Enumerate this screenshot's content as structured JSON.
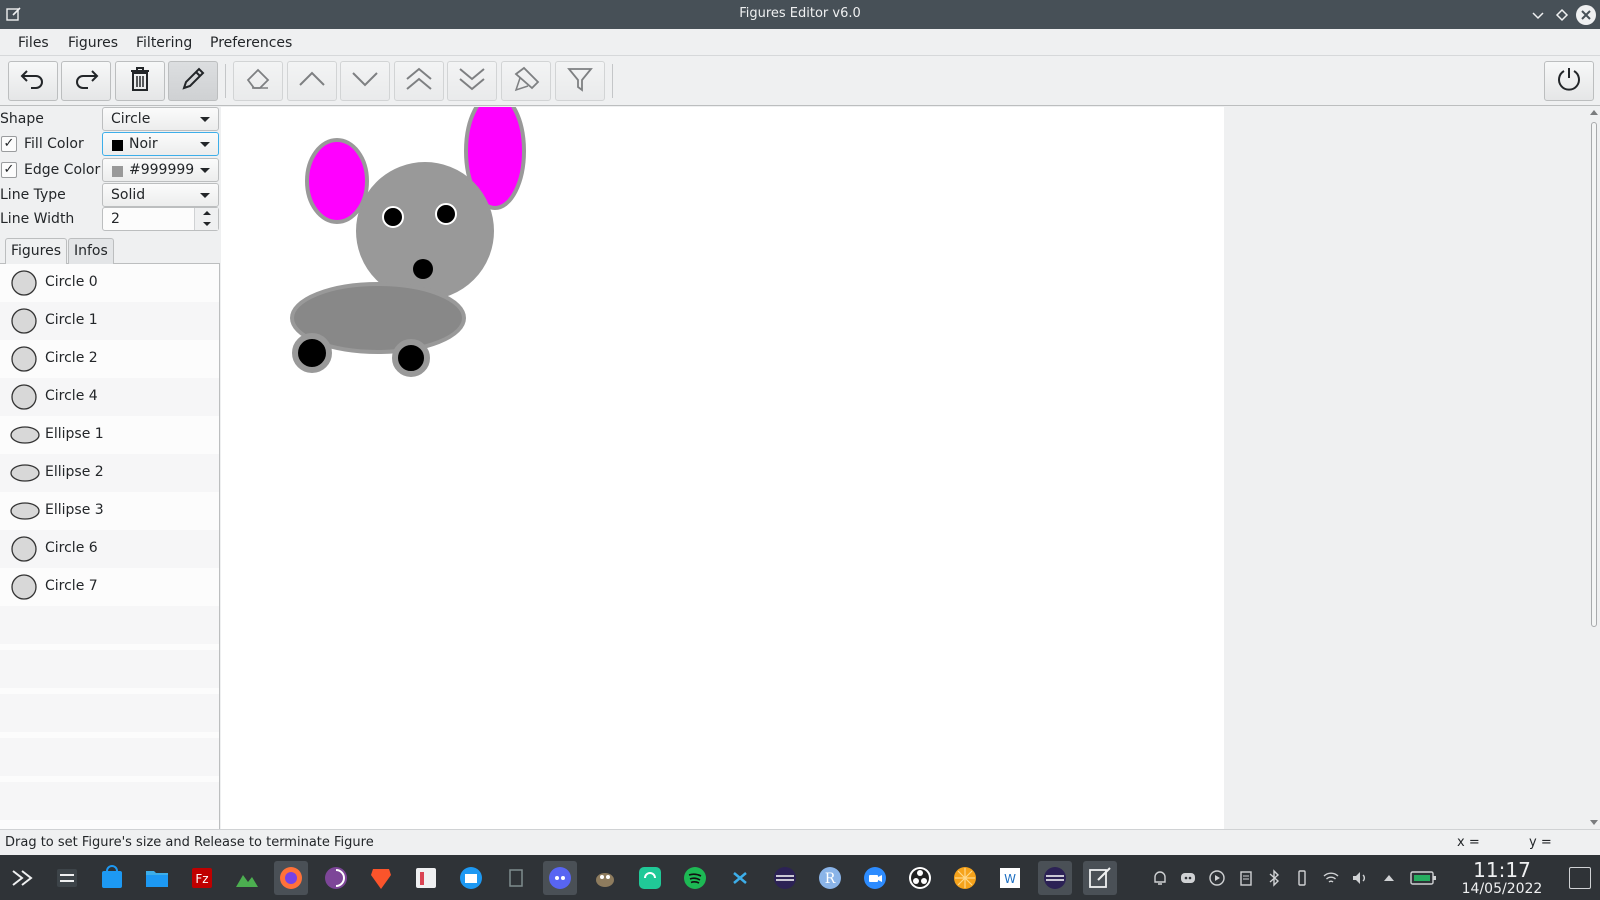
{
  "window": {
    "title": "Figures Editor v6.0"
  },
  "menu": {
    "files": "Files",
    "figures": "Figures",
    "filtering": "Filtering",
    "preferences": "Preferences"
  },
  "toolbar": {
    "buttons": [
      "undo-icon",
      "redo-icon",
      "trash-icon",
      "pencil-icon",
      "eraser-icon",
      "move-up-icon",
      "move-down-icon",
      "move-top-icon",
      "move-bottom-icon",
      "brush-icon",
      "filter-icon",
      "power-icon"
    ]
  },
  "properties": {
    "shape_label": "Shape",
    "shape_value": "Circle",
    "fill_label": "Fill Color",
    "fill_checked": true,
    "fill_value": "Noir",
    "fill_color": "#000000",
    "edge_label": "Edge Color",
    "edge_checked": true,
    "edge_value": "#999999",
    "edge_color": "#999999",
    "line_type_label": "Line Type",
    "line_type_value": "Solid",
    "line_width_label": "Line Width",
    "line_width_value": "2"
  },
  "tabs": {
    "figures": "Figures",
    "infos": "Infos"
  },
  "figures": [
    {
      "label": "Circle 0",
      "kind": "circle"
    },
    {
      "label": "Circle 1",
      "kind": "circle"
    },
    {
      "label": "Circle 2",
      "kind": "circle"
    },
    {
      "label": "Circle 4",
      "kind": "circle"
    },
    {
      "label": "Ellipse 1",
      "kind": "ellipse"
    },
    {
      "label": "Ellipse 2",
      "kind": "ellipse"
    },
    {
      "label": "Ellipse 3",
      "kind": "ellipse"
    },
    {
      "label": "Circle 6",
      "kind": "circle"
    },
    {
      "label": "Circle 7",
      "kind": "circle"
    }
  ],
  "canvas": {
    "colors": {
      "ear": "#ff00ff",
      "body": "#999999",
      "belly": "#888888",
      "eye": "#000000"
    }
  },
  "status": {
    "message": "Drag to set Figure's size and Release to terminate Figure",
    "x_label": "x =",
    "y_label": "y ="
  },
  "taskbar": {
    "apps": [
      "application-launcher-icon",
      "settings-icon",
      "store-icon",
      "file-manager-icon",
      "filezilla-icon",
      "image-viewer-icon",
      "firefox-icon",
      "tor-icon",
      "brave-icon",
      "presenter-icon",
      "mail-icon",
      "notes-icon",
      "discord-icon",
      "gimp-icon",
      "sync-icon",
      "spotify-icon",
      "vscode-icon",
      "eclipse-icon",
      "r-icon",
      "zoom-icon",
      "obs-icon",
      "orange-icon",
      "wps-icon",
      "eclipse-running-icon",
      "figures-editor-icon"
    ],
    "time": "11:17",
    "date": "14/05/2022"
  }
}
